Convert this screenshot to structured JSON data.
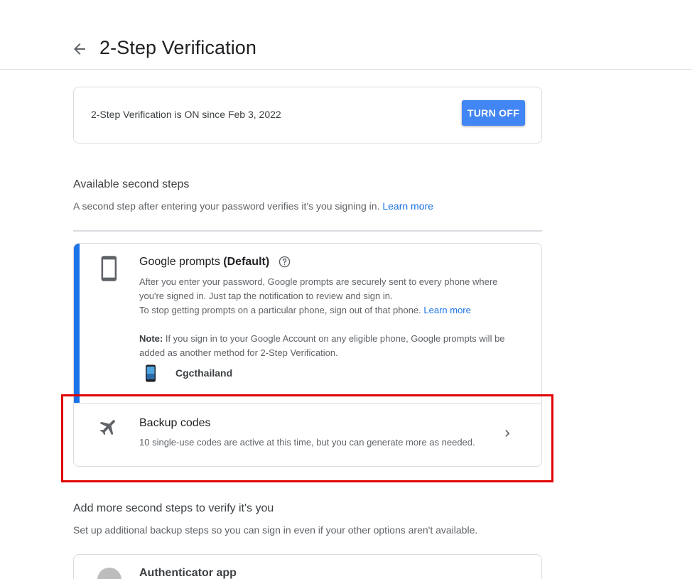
{
  "header": {
    "title": "2-Step Verification",
    "back_icon": "arrow-back-icon"
  },
  "status": {
    "text": "2-Step Verification is ON since Feb 3, 2022",
    "button_label": "TURN OFF",
    "button_color": "#4285f4"
  },
  "available": {
    "title": "Available second steps",
    "description": "A second step after entering your password verifies it's you signing in.",
    "link": "Learn more"
  },
  "methods": {
    "accent_color": "#1a73e8",
    "google_prompts": {
      "icon": "smartphone-icon",
      "title": "Google prompts",
      "title_suffix": "(Default)",
      "help_icon": "help-circle-icon",
      "body_line1": "After you enter your password, Google prompts are securely sent to every phone where",
      "body_line2": "you're signed in. Just tap the notification to review and sign in.",
      "body_line3": "To stop getting prompts on a particular phone, sign out of that phone.",
      "body_link": "Learn more",
      "note_label": "Note:",
      "note_line1": "If you sign in to your Google Account on any eligible phone, Google prompts will be",
      "note_line2": "added as another method for 2-Step Verification.",
      "device_icon": "phone-device-icon",
      "device_name": "Cgcthailand"
    },
    "backup_codes": {
      "icon": "airplane-icon",
      "title": "Backup codes",
      "description": "10 single-use codes are active at this time, but you can generate more as needed.",
      "chevron_icon": "chevron-right-icon"
    }
  },
  "more": {
    "title": "Add more second steps to verify it's you",
    "description": "Set up additional backup steps so you can sign in even if your other options aren't available."
  },
  "authenticator": {
    "icon": "authenticator-icon",
    "title": "Authenticator app"
  },
  "highlight_color": "#e00000"
}
